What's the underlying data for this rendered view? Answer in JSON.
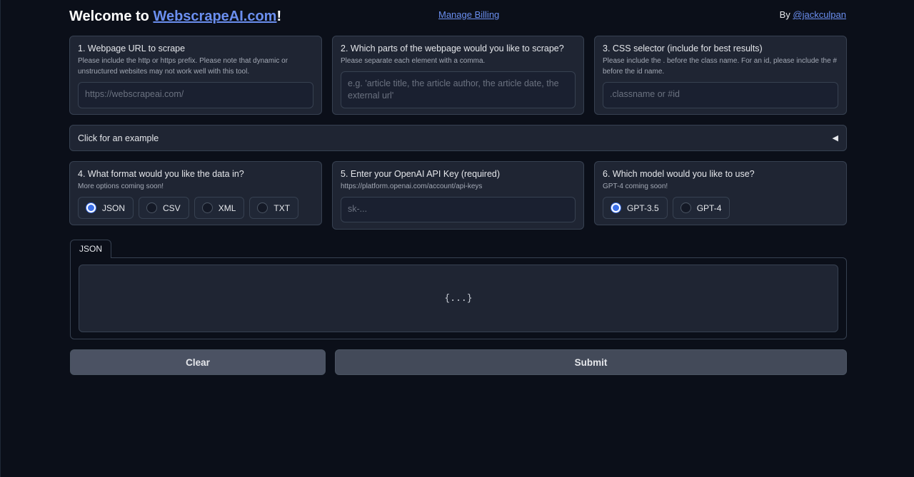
{
  "header": {
    "title_prefix": "Welcome to ",
    "title_link": "WebscrapeAI.com",
    "title_suffix": "!",
    "billing_link": "Manage Billing",
    "by_prefix": "By ",
    "author_link": "@jackculpan"
  },
  "url_card": {
    "title": "1. Webpage URL to scrape",
    "info": "Please include the http or https prefix. Please note that dynamic or unstructured websites may not work well with this tool.",
    "placeholder": "https://webscrapeai.com/"
  },
  "parts_card": {
    "title": "2. Which parts of the webpage would you like to scrape?",
    "info": "Please separate each element with a comma.",
    "placeholder": "e.g. 'article title, the article author, the article date, the external url'"
  },
  "css_card": {
    "title": "3. CSS selector (include for best results)",
    "info": "Please include the . before the class name. For an id, please include the # before the id name.",
    "placeholder": ".classname or #id"
  },
  "example_accordion": {
    "label": "Click for an example",
    "arrow": "◀"
  },
  "format_card": {
    "title": "4. What format would you like the data in?",
    "info": "More options coming soon!",
    "options": [
      "JSON",
      "CSV",
      "XML",
      "TXT"
    ],
    "selected": "JSON"
  },
  "api_card": {
    "title": "5. Enter your OpenAI API Key (required)",
    "info": "https://platform.openai.com/account/api-keys",
    "placeholder": "sk-..."
  },
  "model_card": {
    "title": "6. Which model would you like to use?",
    "info": "GPT-4 coming soon!",
    "options": [
      "GPT-3.5",
      "GPT-4"
    ],
    "selected": "GPT-3.5"
  },
  "output": {
    "tab_label": "JSON",
    "placeholder": "{...}"
  },
  "actions": {
    "clear_label": "Clear",
    "submit_label": "Submit"
  },
  "colors": {
    "background": "#0b0f19",
    "card": "#1f2533",
    "accent": "#3b6fe8",
    "link": "#6b8ff0"
  }
}
